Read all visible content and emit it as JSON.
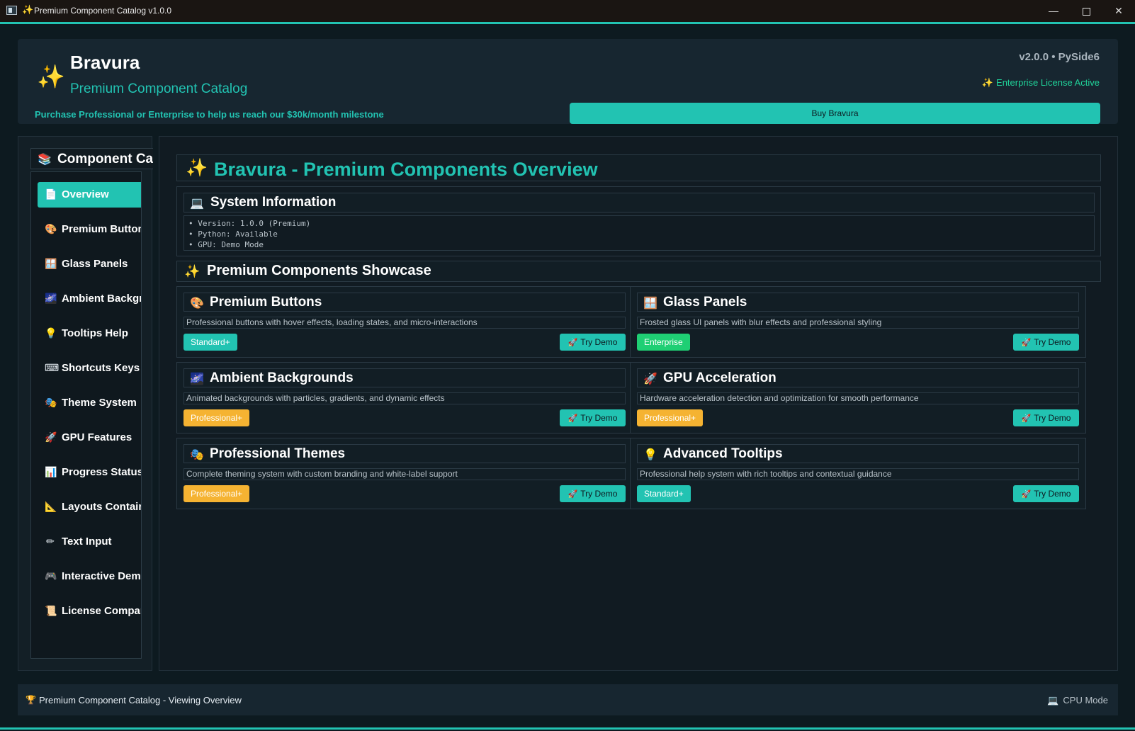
{
  "window": {
    "title": "Premium Component Catalog v1.0.0",
    "icons": {
      "app": "window-icon",
      "title": "sparkles-icon",
      "min": "minimize-icon",
      "max": "maximize-icon",
      "close": "close-icon"
    },
    "controls": {
      "minimize": "—",
      "close": "✕"
    }
  },
  "header": {
    "logo": "✨",
    "brand": "Bravura",
    "subtitle": "Premium Component Catalog",
    "version": "v2.0.0 • PySide6",
    "license_icon": "✨",
    "license": "Enterprise License Active",
    "milestone": "Purchase Professional or Enterprise to help us reach our $30k/month milestone",
    "buy_label": "Buy Bravura"
  },
  "sidebar": {
    "header_icon": "📚",
    "header": "Component Categories",
    "items": [
      {
        "icon": "📄",
        "label": "Overview",
        "active": true
      },
      {
        "icon": "🎨",
        "label": "Premium Buttons"
      },
      {
        "icon": "🪟",
        "label": "Glass Panels"
      },
      {
        "icon": "🌌",
        "label": "Ambient Backgrounds"
      },
      {
        "icon": "💡",
        "label": "Tooltips  Help"
      },
      {
        "icon": "⌨",
        "label": "Shortcuts  Keys"
      },
      {
        "icon": "🎭",
        "label": "Theme System"
      },
      {
        "icon": "🚀",
        "label": "GPU Features"
      },
      {
        "icon": "📊",
        "label": "Progress  Status"
      },
      {
        "icon": "📐",
        "label": "Layouts  Containers"
      },
      {
        "icon": "✏",
        "label": "Text  Input"
      },
      {
        "icon": "🎮",
        "label": "Interactive Demos"
      },
      {
        "icon": "📜",
        "label": "License Comparison"
      }
    ]
  },
  "main": {
    "title_icon": "✨",
    "title": "Bravura - Premium Components Overview",
    "system": {
      "icon": "💻",
      "title": "System Information",
      "lines": [
        "• Version: 1.0.0 (Premium)",
        "• Python: Available",
        "• GPU: Demo Mode"
      ]
    },
    "showcase_icon": "✨",
    "showcase_title": "Premium Components Showcase",
    "try_icon": "🚀",
    "try_label": "Try Demo",
    "cards": [
      {
        "icon": "🎨",
        "title": "Premium Buttons",
        "desc": "Professional buttons with hover effects, loading states, and micro-interactions",
        "badge": "Standard+",
        "badge_color": "#22c3b2"
      },
      {
        "icon": "🪟",
        "title": "Glass Panels",
        "desc": "Frosted glass UI panels with blur effects and professional styling",
        "badge": "Enterprise",
        "badge_color": "#1fcf74"
      },
      {
        "icon": "🌌",
        "title": "Ambient Backgrounds",
        "desc": "Animated backgrounds with particles, gradients, and dynamic effects",
        "badge": "Professional+",
        "badge_color": "#f5b332"
      },
      {
        "icon": "🚀",
        "title": "GPU Acceleration",
        "desc": "Hardware acceleration detection and optimization for smooth performance",
        "badge": "Professional+",
        "badge_color": "#f5b332"
      },
      {
        "icon": "🎭",
        "title": "Professional Themes",
        "desc": "Complete theming system with custom branding and white-label support",
        "badge": "Professional+",
        "badge_color": "#f5b332"
      },
      {
        "icon": "💡",
        "title": "Advanced Tooltips",
        "desc": "Professional help system with rich tooltips and contextual guidance",
        "badge": "Standard+",
        "badge_color": "#22c3b2"
      }
    ]
  },
  "status": {
    "icon": "🏆",
    "text": "Premium Component Catalog - Viewing Overview",
    "cpu_icon": "💻",
    "cpu": "CPU Mode"
  },
  "colors": {
    "accent": "#22c3b2",
    "background": "#0d1a20",
    "panel": "#172630",
    "enterprise_badge": "#1fcf74",
    "professional_badge": "#f5b332",
    "license_text": "#20d39a"
  }
}
